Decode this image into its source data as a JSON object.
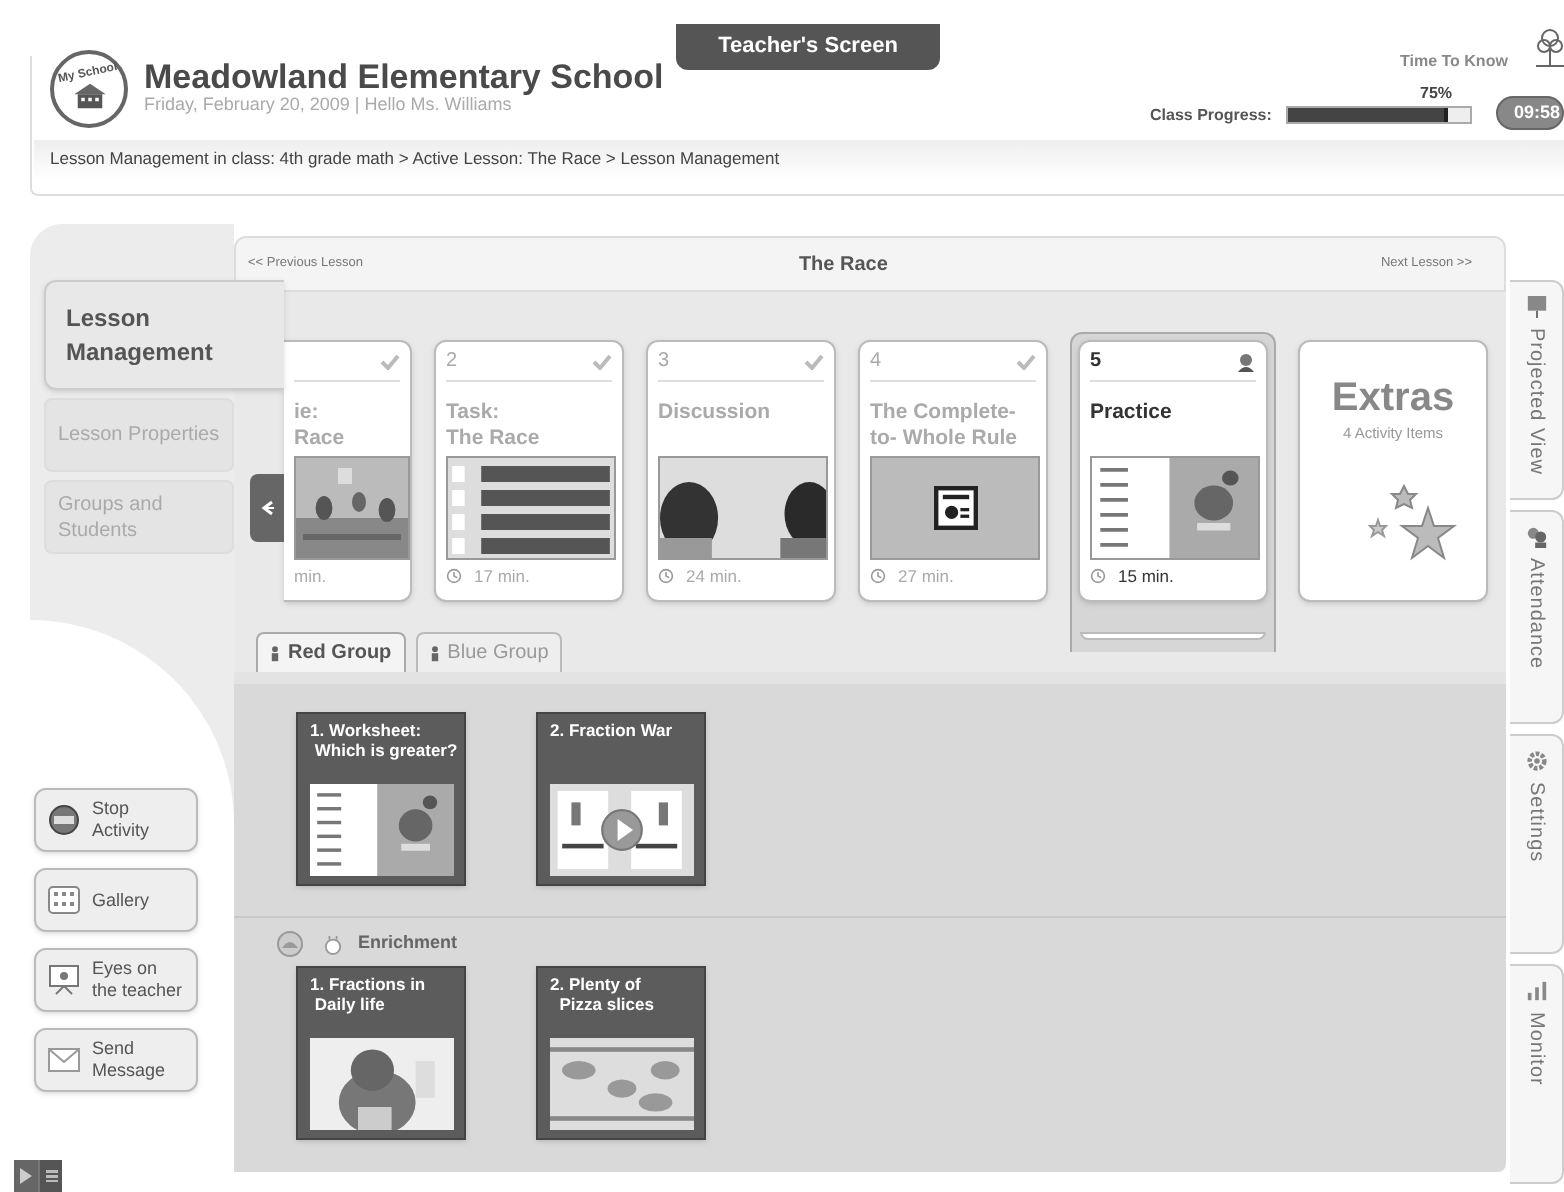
{
  "header": {
    "logo_text": "My School",
    "school": "Meadowland Elementary School",
    "subtitle": "Friday, February 20, 2009 | Hello Ms. Williams",
    "badge": "Teacher's Screen",
    "brand": "Time To Know",
    "progress_label": "Class Progress:",
    "progress_value": "75%",
    "level": 0.88,
    "timer": "09:58"
  },
  "breadcrumb": "Lesson Management in class: 4th grade math > Active Lesson:  The Race > Lesson Management",
  "lesson_nav": {
    "previous": "<< Previous Lesson",
    "title": "The Race",
    "next": "Next Lesson >>"
  },
  "left_tabs": [
    {
      "label": "Lesson Management",
      "selected": true
    },
    {
      "label": "Lesson Properties",
      "selected": false
    },
    {
      "label": "Groups and Students",
      "selected": false
    }
  ],
  "cards": [
    {
      "kind": "partial",
      "title": "ie:\nRace",
      "time": "min.",
      "done": true,
      "selected": false
    },
    {
      "kind": "lesson",
      "number": "2",
      "title": "Task:\nThe Race",
      "thumb": {
        "kind": "sliders"
      },
      "time": "17 min.",
      "done": true,
      "selected": false
    },
    {
      "kind": "lesson",
      "number": "3",
      "title": "Discussion",
      "time": "24 min.",
      "done": true,
      "selected": false
    },
    {
      "kind": "lesson",
      "number": "4",
      "title": "The Complete-\nto- Whole Rule",
      "thumb": {
        "kind": "presentation"
      },
      "time": "27 min.",
      "done": true,
      "selected": false
    },
    {
      "kind": "lesson",
      "number": "5",
      "title": "Practice",
      "thumb": {
        "kind": "worksheet"
      },
      "time": "15 min.",
      "done": false,
      "selected": true
    },
    {
      "kind": "extras",
      "title": "Extras",
      "subtitle": "4 Activity Items",
      "selected": false
    }
  ],
  "group_tabs": [
    {
      "label": "Red Group",
      "selected": true
    },
    {
      "label": "Blue Group",
      "selected": false
    }
  ],
  "activities": [
    {
      "title": "1. Worksheet:\n Which is greater?",
      "thumb": {
        "kind": "worksheet"
      }
    },
    {
      "title": "2. Fraction War",
      "thumb": {
        "kind": "video"
      }
    }
  ],
  "enrichment": {
    "label": "Enrichment",
    "activities": [
      {
        "title": "1. Fractions in\n Daily life"
      },
      {
        "title": "2. Plenty of\n  Pizza slices"
      }
    ]
  },
  "actions": [
    {
      "kind": "stop",
      "label": "Stop\nActivity"
    },
    {
      "kind": "gallery",
      "label": "Gallery"
    },
    {
      "kind": "board",
      "label": "Eyes on\nthe teacher"
    },
    {
      "kind": "message",
      "label": "Send\nMessage"
    }
  ],
  "side_tabs": [
    {
      "kind": "projector",
      "label": "Projected View"
    },
    {
      "kind": "people",
      "label": "Attendance"
    },
    {
      "kind": "gear",
      "label": "Settings"
    },
    {
      "kind": "chart",
      "label": "Monitor"
    }
  ]
}
